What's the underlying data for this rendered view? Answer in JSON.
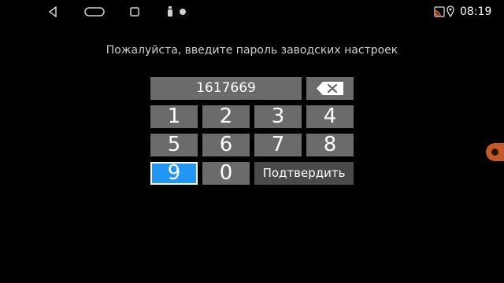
{
  "status_bar": {
    "time": "08:19",
    "icons": [
      "back-icon",
      "home-icon",
      "recent-apps-icon",
      "usb-icon",
      "notification-dot-icon",
      "cast-icon",
      "location-icon"
    ]
  },
  "prompt": "Пожалуйста, введите пароль заводских настроек",
  "password_field": {
    "value": "1617669"
  },
  "keypad": {
    "keys": [
      "1",
      "2",
      "3",
      "4",
      "5",
      "6",
      "7",
      "8",
      "9",
      "0"
    ],
    "selected_key": "9",
    "confirm_label": "Подтвердить"
  },
  "colors": {
    "background": "#000000",
    "key": "#6b6b6b",
    "key_dark": "#4a4a4a",
    "selected": "#2196f3",
    "floating_ball": "#c45a2a"
  }
}
